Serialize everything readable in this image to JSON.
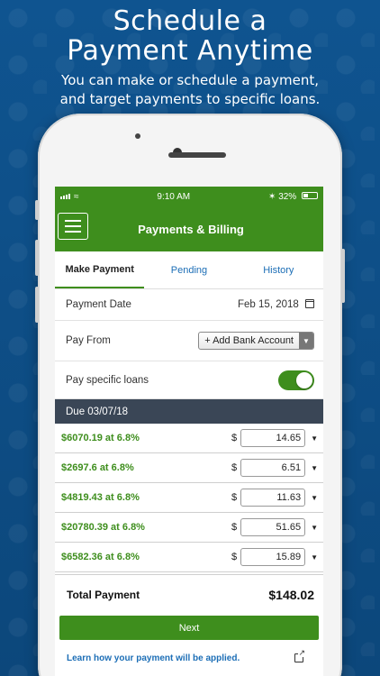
{
  "promo": {
    "title_line1": "Schedule a",
    "title_line2": "Payment Anytime",
    "subtitle_line1": "You can make or schedule a payment,",
    "subtitle_line2": "and target payments to specific loans."
  },
  "status_bar": {
    "time": "9:10 AM",
    "battery": "32%",
    "bluetooth_icon": "bluetooth-icon"
  },
  "app_bar": {
    "title": "Payments & Billing",
    "menu_icon": "hamburger-icon"
  },
  "tabs": [
    {
      "label": "Make Payment",
      "active": true
    },
    {
      "label": "Pending",
      "active": false
    },
    {
      "label": "History",
      "active": false
    }
  ],
  "form": {
    "payment_date_label": "Payment Date",
    "payment_date_value": "Feb 15, 2018",
    "pay_from_label": "Pay From",
    "pay_from_value": "+ Add Bank Account",
    "pay_specific_label": "Pay specific loans",
    "pay_specific_on": true
  },
  "due_header": "Due 03/07/18",
  "loans": [
    {
      "label": "$6070.19 at 6.8%",
      "currency": "$",
      "amount": "14.65"
    },
    {
      "label": "$2697.6 at 6.8%",
      "currency": "$",
      "amount": "6.51"
    },
    {
      "label": "$4819.43 at 6.8%",
      "currency": "$",
      "amount": "11.63"
    },
    {
      "label": "$20780.39 at 6.8%",
      "currency": "$",
      "amount": "51.65"
    },
    {
      "label": "$6582.36 at 6.8%",
      "currency": "$",
      "amount": "15.89"
    }
  ],
  "total": {
    "label": "Total Payment",
    "value": "$148.02"
  },
  "next_label": "Next",
  "learn_link": "Learn how your payment will be applied.",
  "colors": {
    "brand_green": "#3e8e1d",
    "link_blue": "#1c6eb6",
    "due_header_bg": "#3a4656",
    "background_blue": "#0e4a7f"
  }
}
